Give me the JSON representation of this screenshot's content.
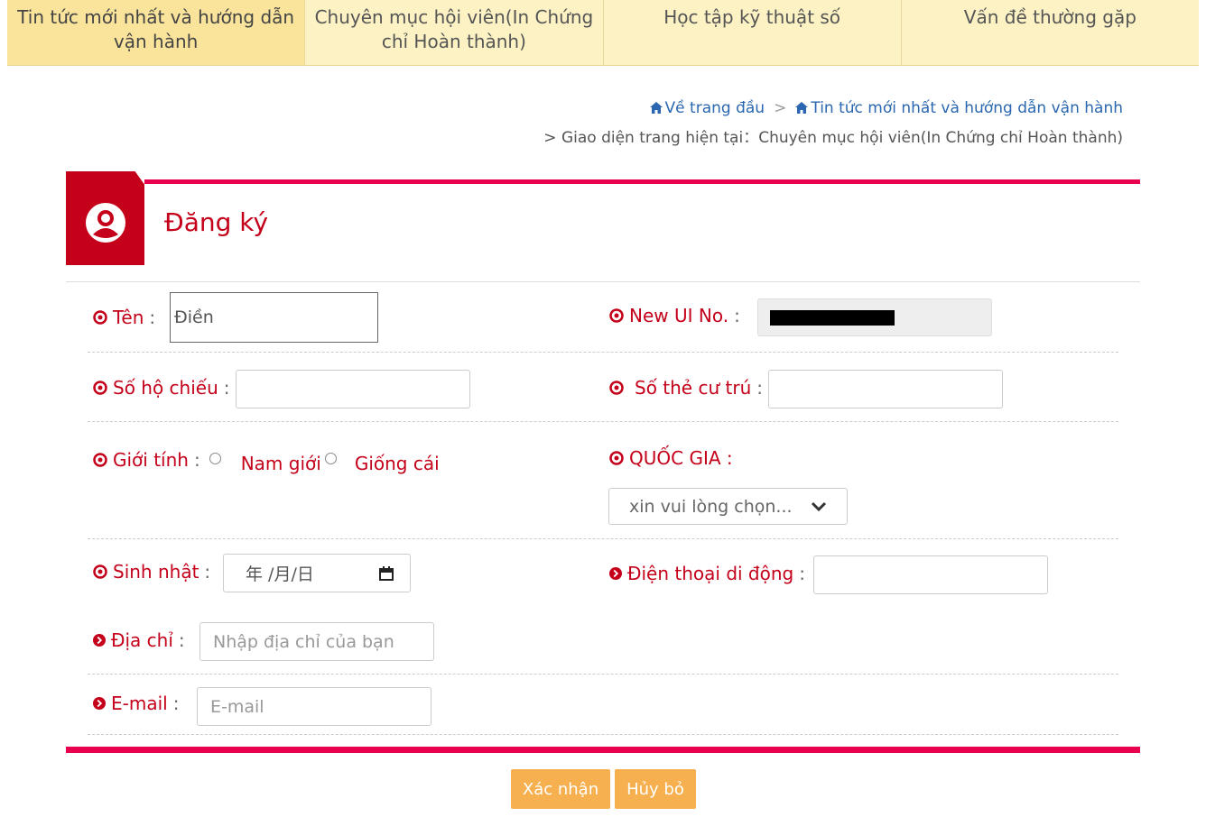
{
  "nav": {
    "tabs": [
      {
        "label": "Tin tức mới nhất và hướng dẫn vận hành"
      },
      {
        "label": "Chuyên mục hội viên(In Chứng chỉ Hoàn thành)"
      },
      {
        "label": "Học tập kỹ thuật số"
      },
      {
        "label": "Vấn đề thường gặp"
      }
    ]
  },
  "breadcrumb": {
    "home": "Về trang đầu",
    "separator": ">",
    "news": "Tin tức mới nhất và hướng dẫn vận hành",
    "current_prefix": "> Giao diện trang hiện tại：Chuyên mục hội viên(In Chứng chỉ Hoàn thành)"
  },
  "form": {
    "title": "Đăng ký",
    "name_label": "Tên",
    "name_value": "Điền",
    "new_ui_label": "New UI No.",
    "passport_label": "Số hộ chiếu",
    "residence_label": "Số thẻ cư trú",
    "gender_label": "Giới tính",
    "gender_male": "Nam giới",
    "gender_female": "Giống cái",
    "country_label": "QUỐC GIA :",
    "country_placeholder": "xin vui lòng chọn...",
    "birthday_label": "Sinh nhật",
    "birthday_placeholder": "年 /月/日",
    "phone_label": "Điện thoại di động",
    "address_label": "Địa chỉ",
    "address_placeholder": "Nhập địa chỉ của bạn",
    "email_label": "E-mail",
    "email_placeholder": "E-mail",
    "colon": ":"
  },
  "buttons": {
    "confirm": "Xác nhận",
    "cancel": "Hủy bỏ"
  },
  "colors": {
    "accent": "#c4001a",
    "line": "#e8004f",
    "button": "#f6b04f",
    "nav_bg": "#fdf2c4"
  }
}
